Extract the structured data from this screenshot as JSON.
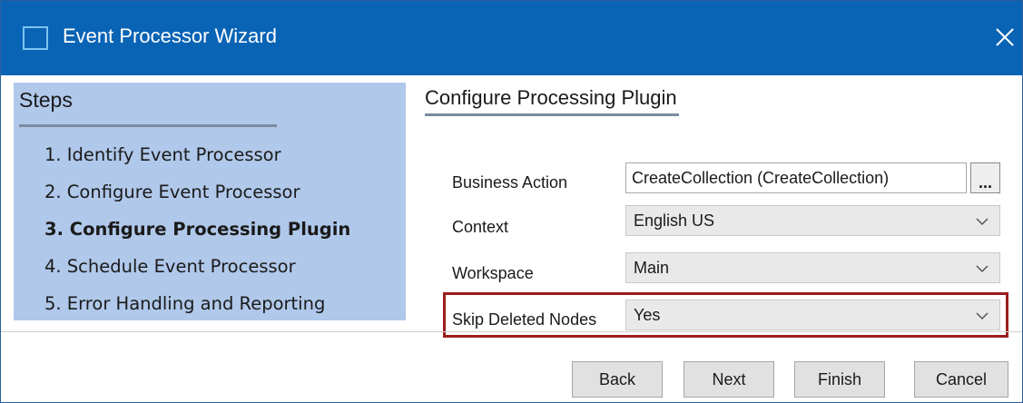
{
  "window": {
    "title": "Event Processor Wizard"
  },
  "steps": {
    "heading": "Steps",
    "items": [
      {
        "label": "1. Identify Event Processor",
        "current": false
      },
      {
        "label": "2. Configure Event Processor",
        "current": false
      },
      {
        "label": "3. Configure Processing Plugin",
        "current": true
      },
      {
        "label": "4. Schedule Event Processor",
        "current": false
      },
      {
        "label": "5. Error Handling and Reporting",
        "current": false
      }
    ]
  },
  "section": {
    "title": "Configure Processing Plugin"
  },
  "form": {
    "business_action": {
      "label": "Business Action",
      "value": "CreateCollection (CreateCollection)",
      "browse_label": "..."
    },
    "context": {
      "label": "Context",
      "value": "English US"
    },
    "workspace": {
      "label": "Workspace",
      "value": "Main"
    },
    "skip_deleted_nodes": {
      "label": "Skip Deleted Nodes",
      "value": "Yes"
    }
  },
  "footer": {
    "back_label": "Back",
    "next_label": "Next",
    "finish_label": "Finish",
    "cancel_label": "Cancel"
  },
  "colors": {
    "titlebar": "#0a64b5",
    "steps_panel": "#b0c8ea",
    "highlight_border": "#9b1c1c"
  },
  "icons": {
    "app": "window-icon",
    "close": "close-icon",
    "combo": "chevron-down-icon"
  }
}
